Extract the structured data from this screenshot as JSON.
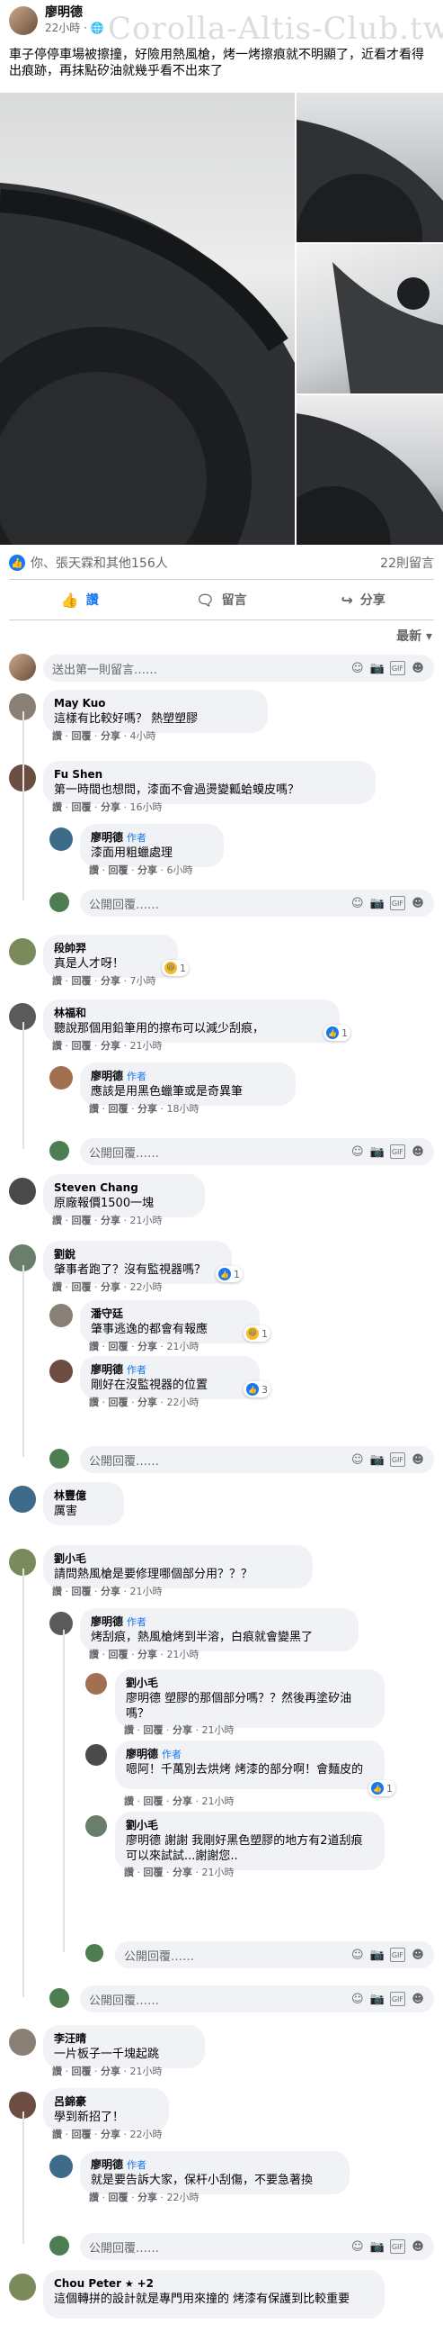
{
  "post": {
    "author": "廖明德",
    "time": "22小時",
    "privacy_icon": "globe-icon",
    "watermark": "Corolla-Altis-Club.tw",
    "text": "車子停停車場被擦撞，好險用熱風槍，烤一烤擦痕就不明顯了，近看才看得出痕跡，再抹點矽油就幾乎看不出來了"
  },
  "reactions": {
    "summary": "你、張天霖和其他156人",
    "comments_count": "22則留言"
  },
  "actions": {
    "like": "讚",
    "comment": "留言",
    "share": "分享"
  },
  "sort_label": "最新",
  "composer_placeholder": "送出第一則留言……",
  "reply_placeholder": "公開回覆……",
  "meta": {
    "like": "讚",
    "reply": "回覆",
    "share": "分享"
  },
  "author_badge": "作者",
  "comments": [
    {
      "name": "May Kuo",
      "text": "這樣有比較好嗎？ 熱塑塑膠",
      "time": "4小時"
    },
    {
      "name": "Fu Shen",
      "text": "第一時間也想問，漆面不會過燙變瓤蛤蟆皮嗎？",
      "time": "16小時"
    },
    {
      "name": "廖明德",
      "text": "漆面用粗蠟處理",
      "time": "6小時"
    },
    {
      "name": "段帥羿",
      "text": "真是人才呀！",
      "time": "7小時",
      "react": "1"
    },
    {
      "name": "林福和",
      "text": "聽說那個用鉛筆用的擦布可以減少刮痕，",
      "time": "21小時",
      "react": "1"
    },
    {
      "name": "廖明德",
      "text": "應該是用黑色蠟筆或是奇異筆",
      "time": "18小時"
    },
    {
      "name": "Steven Chang",
      "text": "原廠報價1500一塊",
      "time": "21小時"
    },
    {
      "name": "劉銳",
      "text": "肇事者跑了？沒有監視器嗎？",
      "time": "22小時",
      "react": "1"
    },
    {
      "name": "潘守廷",
      "text": "肇事逃逸的都會有報應",
      "time": "21小時",
      "react": "1"
    },
    {
      "name": "廖明德",
      "text": "剛好在沒監視器的位置",
      "time": "22小時",
      "react": "3"
    },
    {
      "name": "林豐億",
      "text": "厲害",
      "time": ""
    },
    {
      "name": "劉小毛",
      "text": "請問熱風槍是要修理哪個部分用？？？",
      "time": "21小時"
    },
    {
      "name": "廖明德",
      "text": "烤刮痕，熱風槍烤到半溶，白痕就會變黑了",
      "time": "21小時"
    },
    {
      "name": "劉小毛",
      "text": "廖明德 塑膠的那個部分嗎？？然後再塗矽油嗎？",
      "time": "21小時"
    },
    {
      "name": "廖明德",
      "text": "嗯阿！千萬別去烘烤 烤漆的部分啊！會麵皮的",
      "time": "21小時",
      "react": "1"
    },
    {
      "name": "劉小毛",
      "text": "廖明德 謝謝 我剛好黑色塑膠的地方有2道刮痕 可以來試試...謝謝您..",
      "time": "21小時"
    },
    {
      "name": "李汪晴",
      "text": "一片板子一千塊起跳",
      "time": "21小時"
    },
    {
      "name": "呂錦豪",
      "text": "學到新招了！",
      "time": "22小時"
    },
    {
      "name": "廖明德",
      "text": "就是要告訴大家，保杆小刮傷，不要急著換",
      "time": "22小時"
    },
    {
      "name": "Chou Peter",
      "extra": "+2",
      "text": "這個轉拼的設計就是專門用來撞的 烤漆有保護到比較重要",
      "time": ""
    }
  ],
  "colors": {
    "accent": "#1877f2",
    "bubble": "#f0f2f5",
    "meta": "#65676b"
  }
}
